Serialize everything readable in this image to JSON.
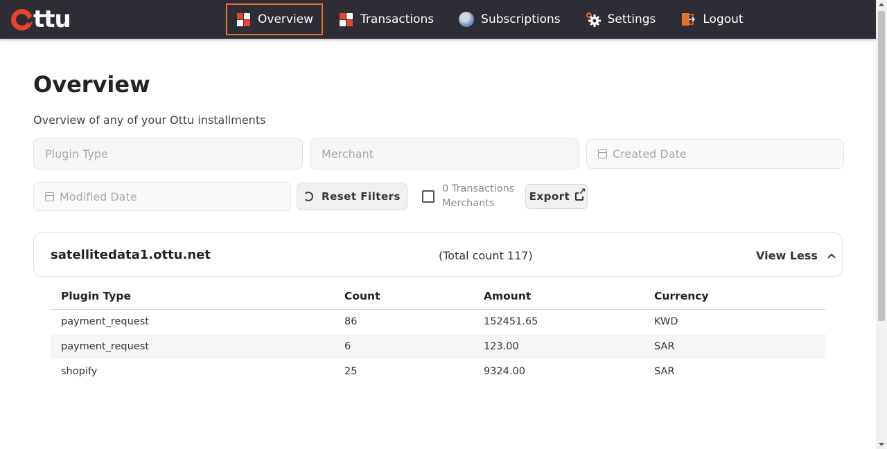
{
  "brand": {
    "logo_text": "ttu",
    "accent": "#e8452c",
    "nav_bg": "#2e2d36",
    "active_border": "#e8722c"
  },
  "nav": {
    "items": [
      {
        "label": "Overview",
        "icon": "grid-icon",
        "active": true
      },
      {
        "label": "Transactions",
        "icon": "grid-icon",
        "active": false
      },
      {
        "label": "Subscriptions",
        "icon": "globe-icon",
        "active": false
      },
      {
        "label": "Settings",
        "icon": "gear-icon",
        "active": false
      },
      {
        "label": "Logout",
        "icon": "door-icon",
        "active": false
      }
    ]
  },
  "page": {
    "title": "Overview",
    "subtitle": "Overview of any of your Ottu installments"
  },
  "filters": {
    "plugin_type_placeholder": "Plugin Type",
    "merchant_placeholder": "Merchant",
    "created_date_placeholder": "Created Date",
    "modified_date_placeholder": "Modified Date",
    "reset_label": "Reset Filters",
    "checkbox_label_line1": "0 Transactions",
    "checkbox_label_line2": "Merchants",
    "checkbox_checked": false,
    "export_label": "Export"
  },
  "card": {
    "domain": "satellitedata1.ottu.net",
    "total_count": "(Total count 117)",
    "toggle_label": "View Less"
  },
  "table": {
    "headers": [
      "Plugin Type",
      "Count",
      "Amount",
      "Currency"
    ],
    "rows": [
      [
        "payment_request",
        "86",
        "152451.65",
        "KWD"
      ],
      [
        "payment_request",
        "6",
        "123.00",
        "SAR"
      ],
      [
        "shopify",
        "25",
        "9324.00",
        "SAR"
      ]
    ]
  }
}
